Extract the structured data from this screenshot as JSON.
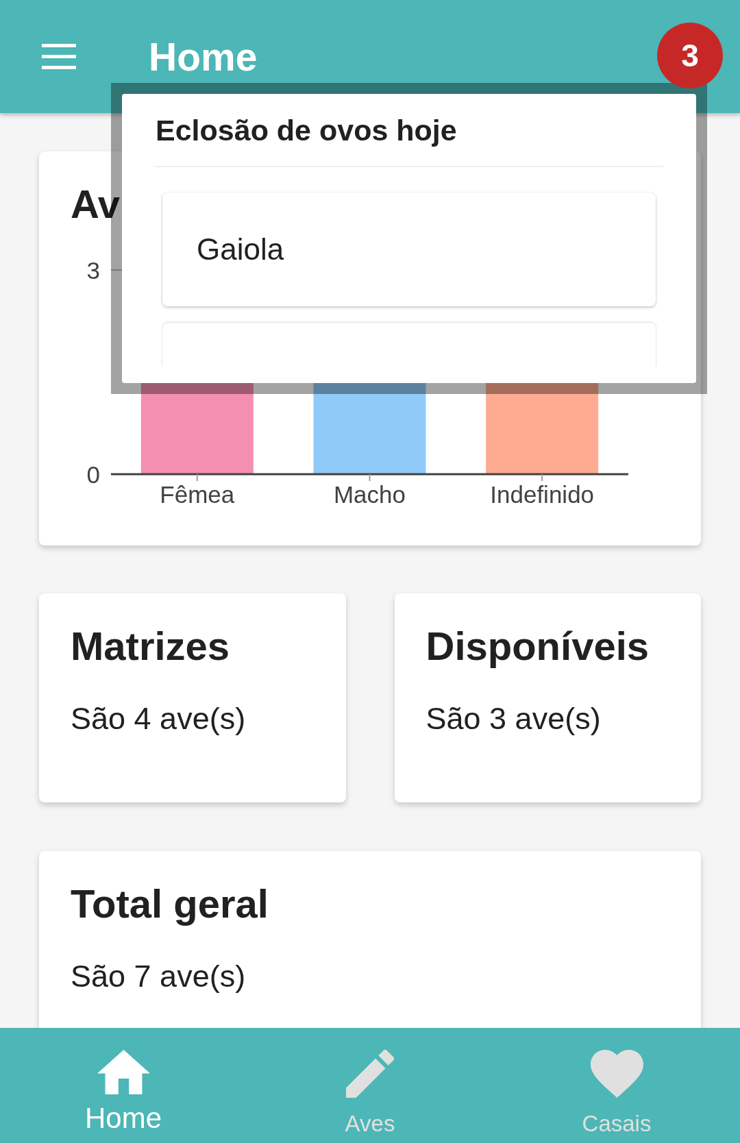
{
  "app_bar": {
    "title": "Home",
    "badge": "3"
  },
  "chart_card": {
    "title": "Av",
    "axis_labels": [
      "3",
      "0"
    ],
    "bars": [
      {
        "label": "Fêmea",
        "color": "#f48fb1"
      },
      {
        "label": "Macho",
        "color": "#90caf9"
      },
      {
        "label": "Indefinido",
        "color": "#ffab91"
      }
    ]
  },
  "summary_cards": [
    {
      "title": "Matrizes",
      "text": "São 4 ave(s)"
    },
    {
      "title": "Disponíveis",
      "text": "São 3 ave(s)"
    }
  ],
  "total_card": {
    "title": "Total geral",
    "text": "São 7 ave(s)"
  },
  "dialog": {
    "title": "Eclosão de ovos hoje",
    "items": [
      {
        "kind": "text",
        "label": "Gaiola"
      },
      {
        "kind": "cut"
      }
    ]
  },
  "bottom_nav": [
    {
      "label": "Home",
      "selected": true
    },
    {
      "label": "Aves",
      "selected": false
    },
    {
      "label": "Casais",
      "selected": false
    }
  ]
}
